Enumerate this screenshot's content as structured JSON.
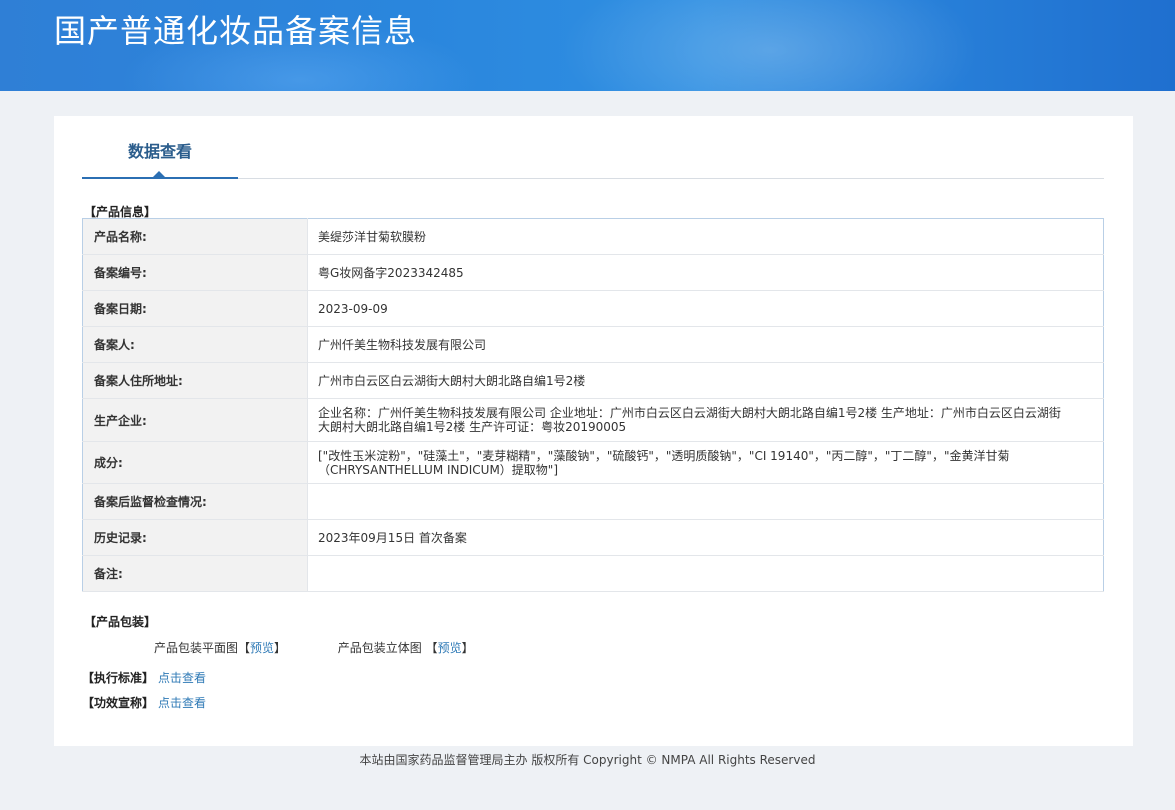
{
  "header": {
    "title": "国产普通化妆品备案信息"
  },
  "tabs": [
    {
      "label": "数据查看",
      "active": true
    }
  ],
  "product_info": {
    "section_label": "【产品信息】",
    "rows": [
      {
        "key": "产品名称:",
        "value": "美缇莎洋甘菊软膜粉"
      },
      {
        "key": "备案编号:",
        "value": "粤G妆网备字2023342485"
      },
      {
        "key": "备案日期:",
        "value": "2023-09-09"
      },
      {
        "key": "备案人:",
        "value": "广州仟美生物科技发展有限公司"
      },
      {
        "key": "备案人住所地址:",
        "value": "广州市白云区白云湖街大朗村大朗北路自编1号2楼"
      },
      {
        "key": "生产企业:",
        "value": "企业名称：广州仟美生物科技发展有限公司 企业地址：广州市白云区白云湖街大朗村大朗北路自编1号2楼 生产地址：广州市白云区白云湖街大朗村大朗北路自编1号2楼 生产许可证：粤妆20190005"
      },
      {
        "key": "成分:",
        "value": "[\"改性玉米淀粉\"，\"硅藻土\"，\"麦芽糊精\"，\"藻酸钠\"，\"硫酸钙\"，\"透明质酸钠\"，\"CI 19140\"，\"丙二醇\"，\"丁二醇\"，\"金黄洋甘菊（CHRYSANTHELLUM INDICUM）提取物\"]"
      },
      {
        "key": "备案后监督检查情况:",
        "value": ""
      },
      {
        "key": "历史记录:",
        "value": "2023年09月15日 首次备案"
      },
      {
        "key": "备注:",
        "value": ""
      }
    ]
  },
  "packaging": {
    "section_label": "【产品包装】",
    "flat_label": "产品包装平面图",
    "stereo_label": "产品包装立体图",
    "bracket_open": "【",
    "bracket_open_spaced": " 【",
    "bracket_close": "】",
    "preview_link": "预览"
  },
  "standard": {
    "label": "【执行标准】",
    "link": "点击查看"
  },
  "efficacy": {
    "label": "【功效宣称】",
    "link": "点击查看"
  },
  "footer": {
    "text": "本站由国家药品监督管理局主办 版权所有 Copyright © NMPA All Rights Reserved"
  },
  "colors": {
    "header_blue": "#2a86dd",
    "link": "#2f7ab6",
    "tab_active": "#2b5d8c"
  }
}
